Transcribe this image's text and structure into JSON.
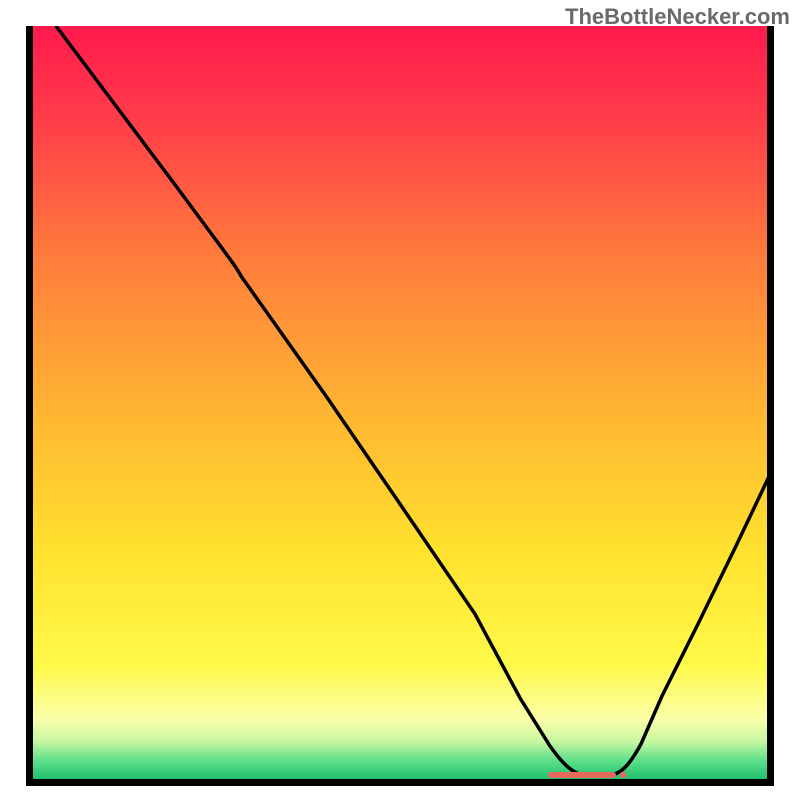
{
  "watermark": "TheBottleNecker.com",
  "chart_data": {
    "type": "line",
    "title": "",
    "xlabel": "",
    "ylabel": "",
    "xlim": [
      0,
      100
    ],
    "ylim": [
      0,
      100
    ],
    "series": [
      {
        "name": "curve",
        "x": [
          4,
          10,
          20,
          28,
          40,
          50,
          60,
          66,
          70,
          72,
          74,
          76,
          78,
          80,
          85,
          90,
          95,
          100
        ],
        "values": [
          100,
          92,
          79,
          70,
          52,
          38,
          23,
          13,
          6,
          3,
          1,
          0.5,
          0.5,
          1,
          8,
          20,
          33,
          48
        ]
      },
      {
        "name": "marker-bar",
        "x": [
          70,
          71,
          72,
          73,
          74,
          75,
          76,
          77,
          78,
          79,
          79.8
        ],
        "values": [
          0.4,
          0.4,
          0.4,
          0.4,
          0.4,
          0.4,
          0.4,
          0.4,
          0.4,
          0.4,
          0.4
        ]
      }
    ],
    "background_gradient": {
      "stops": [
        {
          "offset": 0.0,
          "color": "#ff1a4d"
        },
        {
          "offset": 0.12,
          "color": "#ff3b4a"
        },
        {
          "offset": 0.3,
          "color": "#ff7a3c"
        },
        {
          "offset": 0.5,
          "color": "#ffb233"
        },
        {
          "offset": 0.7,
          "color": "#ffe22e"
        },
        {
          "offset": 0.85,
          "color": "#fff94a"
        },
        {
          "offset": 0.92,
          "color": "#faffa8"
        },
        {
          "offset": 0.95,
          "color": "#c8f7a0"
        },
        {
          "offset": 0.975,
          "color": "#5fe08a"
        },
        {
          "offset": 1.0,
          "color": "#1fc06f"
        }
      ]
    }
  }
}
